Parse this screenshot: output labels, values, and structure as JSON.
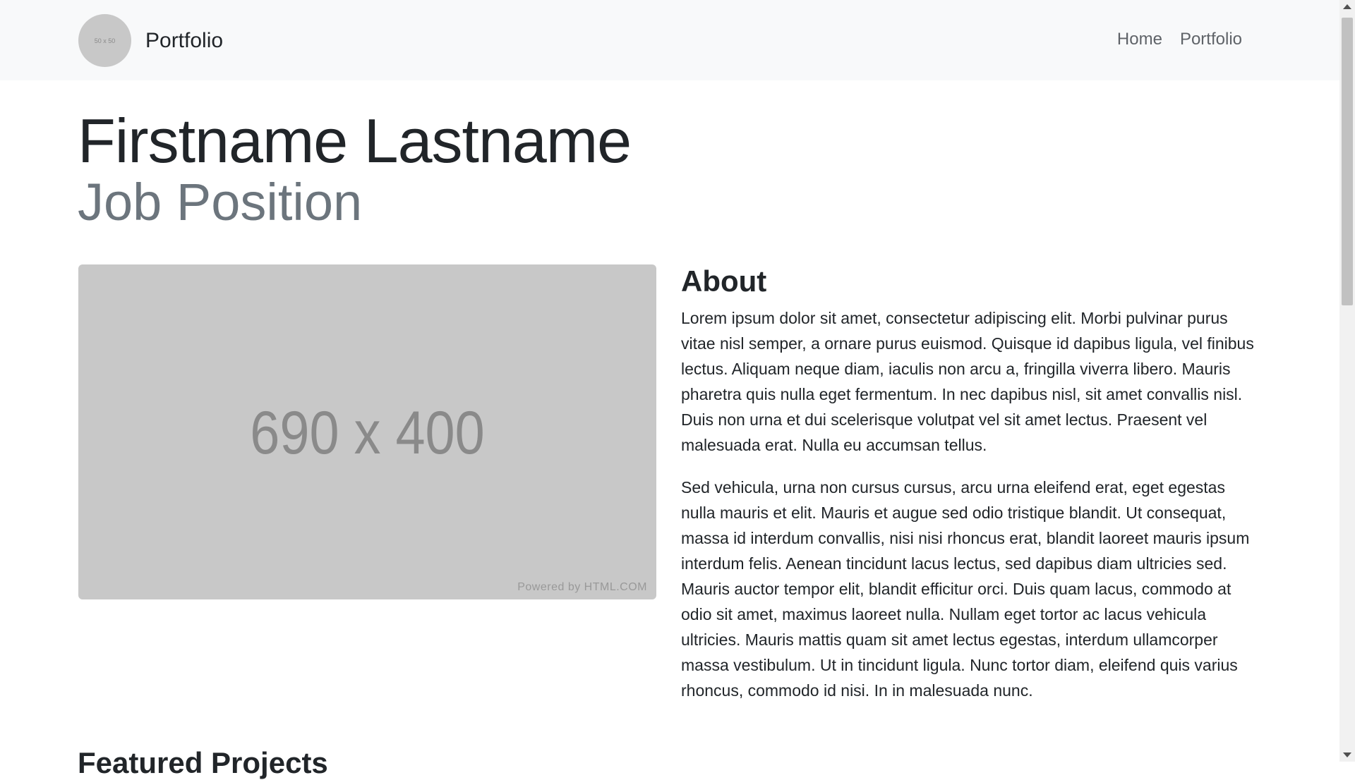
{
  "navbar": {
    "avatar_text": "50 x 50",
    "brand": "Portfolio",
    "links": [
      "Home",
      "Portfolio"
    ]
  },
  "header": {
    "name": "Firstname Lastname",
    "job": "Job Position"
  },
  "image": {
    "size_text": "690 x 400",
    "credit": "Powered by HTML.COM"
  },
  "about": {
    "title": "About",
    "paragraphs": [
      "Lorem ipsum dolor sit amet, consectetur adipiscing elit. Morbi pulvinar purus vitae nisl semper, a ornare purus euismod. Quisque id dapibus ligula, vel finibus lectus. Aliquam neque diam, iaculis non arcu a, fringilla viverra libero. Mauris pharetra quis nulla eget fermentum. In nec dapibus nisl, sit amet convallis nisl. Duis non urna et dui scelerisque volutpat vel sit amet lectus. Praesent vel malesuada erat. Nulla eu accumsan tellus.",
      "Sed vehicula, urna non cursus cursus, arcu urna eleifend erat, eget egestas nulla mauris et elit. Mauris et augue sed odio tristique blandit. Ut consequat, massa id interdum convallis, nisi nisi rhoncus erat, blandit laoreet mauris ipsum interdum felis. Aenean tincidunt lacus lectus, sed dapibus diam ultricies sed. Mauris auctor tempor elit, blandit efficitur orci. Duis quam lacus, commodo at odio sit amet, maximus laoreet nulla. Nullam eget tortor ac lacus vehicula ultricies. Mauris mattis quam sit amet lectus egestas, interdum ullamcorper massa vestibulum. Ut in tincidunt ligula. Nunc tortor diam, eleifend quis varius rhoncus, commodo id nisi. In in malesuada nunc."
    ]
  },
  "featured": {
    "title": "Featured Projects"
  }
}
